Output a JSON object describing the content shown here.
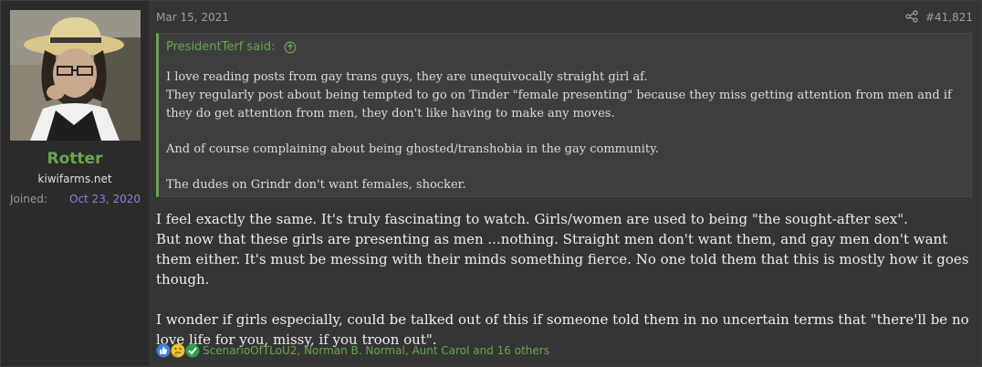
{
  "user": {
    "name": "Rotter",
    "title": "kiwifarms.net",
    "joined_label": "Joined:",
    "joined_value": "Oct 23, 2020"
  },
  "post": {
    "date": "Mar 15, 2021",
    "number": "#41,821",
    "quote": {
      "author": "PresidentTerf said:",
      "lines": [
        "I love reading posts from gay trans guys, they are unequivocally straight girl af.",
        "They regularly post about being tempted to go on Tinder \"female presenting\" because they miss getting attention from men and if they do get attention from men, they don't like having to make any moves.",
        "And of course complaining about being ghosted/transhobia in the gay community.",
        "The dudes on Grindr don't want females, shocker."
      ]
    },
    "body": [
      "I feel exactly the same. It's truly fascinating to watch. Girls/women are used to being \"the sought-after sex\".",
      "But now that these girls are presenting as men ...nothing. Straight men don't want them, and gay men don't want them either. It's must be messing with their minds something fierce. No one told them that this is mostly how it goes though.",
      "I wonder if girls especially, could be talked out of this if someone told them in no uncertain terms that \"there'll be no love life for you, missy, if you troon out\"."
    ],
    "reactions": {
      "icons": [
        "like-icon",
        "thinking-icon",
        "agree-icon"
      ],
      "users": "ScenarioOfTLoU2, Norman B. Normal, Aunt Carol and 16 others"
    }
  },
  "colors": {
    "accent_green": "#6aa84f",
    "joined_purple": "#9d7cd8",
    "background": "#353535"
  }
}
